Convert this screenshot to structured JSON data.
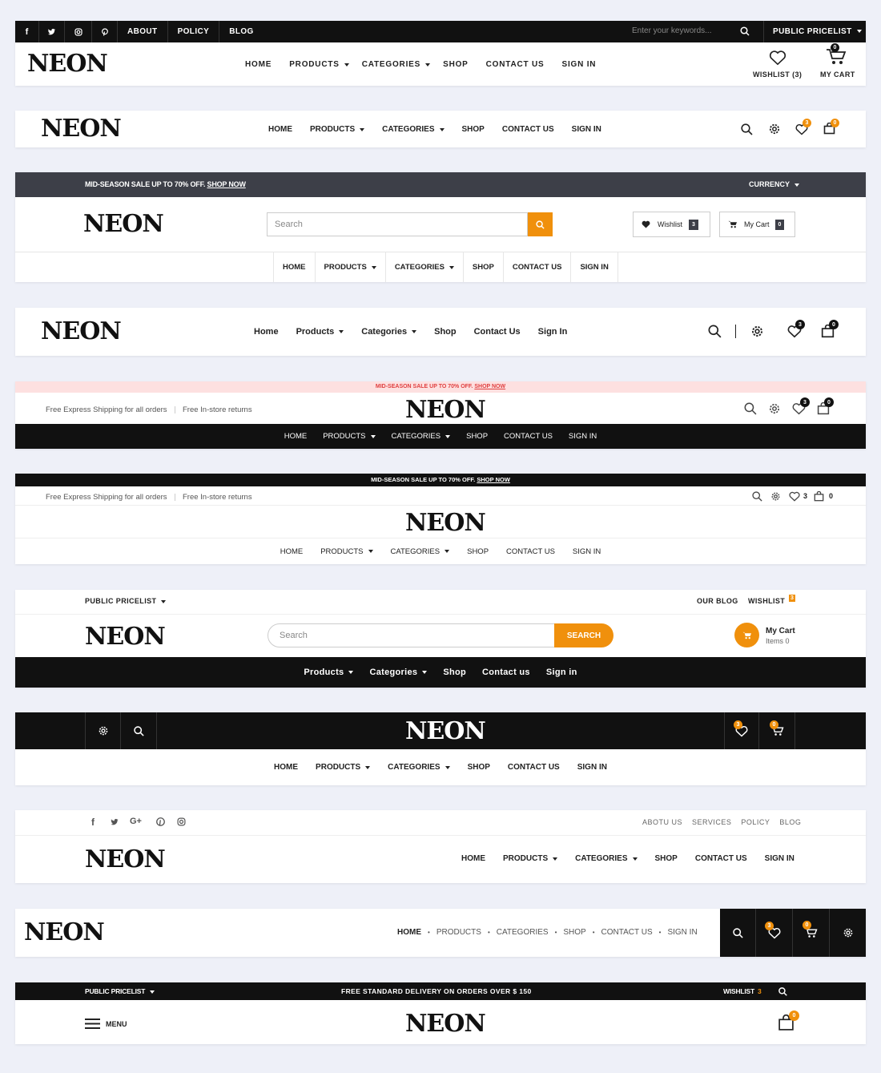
{
  "colors": {
    "accent": "#f0900c",
    "dark": "#111111",
    "slate": "#3d3f48",
    "pink_bar": "#fde0e0",
    "sale_text": "#e04040"
  },
  "h1": {
    "social": [
      "facebook-icon",
      "twitter-icon",
      "instagram-icon",
      "pinterest-icon"
    ],
    "links": [
      "ABOUT",
      "POLICY",
      "BLOG"
    ],
    "search_placeholder": "Enter your keywords...",
    "pricelist": "PUBLIC PRICELIST",
    "logo": "NEON",
    "nav": [
      "HOME",
      "PRODUCTS",
      "CATEGORIES",
      "SHOP",
      "CONTACT US",
      "SIGN IN"
    ],
    "wishlist": "WISHLIST (3)",
    "cart": "MY CART",
    "cart_count": "0"
  },
  "h2": {
    "logo": "NEON",
    "nav": [
      "HOME",
      "PRODUCTS",
      "CATEGORIES",
      "SHOP",
      "CONTACT US",
      "SIGN IN"
    ],
    "wish_count": "3",
    "cart_count": "0"
  },
  "h3": {
    "sale": "MID-SEASON SALE UP TO 70% OFF.",
    "shop_now": "SHOP NOW",
    "currency": "CURRENCY",
    "logo": "NEON",
    "search_placeholder": "Search",
    "wishlist": "Wishlist",
    "wish_count": "3",
    "cart": "My Cart",
    "cart_count": "0",
    "nav": [
      "HOME",
      "PRODUCTS",
      "CATEGORIES",
      "SHOP",
      "CONTACT US",
      "SIGN IN"
    ]
  },
  "h4": {
    "logo": "NEON",
    "nav": [
      "Home",
      "Products",
      "Categories",
      "Shop",
      "Contact Us",
      "Sign In"
    ],
    "wish_count": "3",
    "cart_count": "0"
  },
  "h5": {
    "sale": "MID-SEASON SALE UP TO 70% OFF.",
    "shop_now": "SHOP NOW",
    "shipping": "Free Express Shipping for all orders",
    "returns": "Free In-store returns",
    "logo": "NEON",
    "wish_count": "3",
    "cart_count": "0",
    "nav": [
      "HOME",
      "PRODUCTS",
      "CATEGORIES",
      "SHOP",
      "CONTACT US",
      "SIGN IN"
    ]
  },
  "h6": {
    "sale": "MID-SEASON SALE UP TO 70% OFF.",
    "shop_now": "SHOP NOW",
    "shipping": "Free Express Shipping for all orders",
    "returns": "Free In-store returns",
    "wish_count": "3",
    "cart_count": "0",
    "logo": "NEON",
    "nav": [
      "HOME",
      "PRODUCTS",
      "CATEGORIES",
      "SHOP",
      "CONTACT US",
      "SIGN IN"
    ]
  },
  "h7": {
    "pricelist": "PUBLIC PRICELIST",
    "blog": "OUR BLOG",
    "wishlist": "WISHLIST",
    "wish_count": "3",
    "logo": "NEON",
    "search_placeholder": "Search",
    "search_btn": "SEARCH",
    "cart_title": "My Cart",
    "cart_items": "Items 0",
    "nav": [
      "Products",
      "Categories",
      "Shop",
      "Contact us",
      "Sign in"
    ]
  },
  "h8": {
    "logo": "NEON",
    "wish_count": "3",
    "cart_count": "0",
    "nav": [
      "HOME",
      "PRODUCTS",
      "CATEGORIES",
      "SHOP",
      "CONTACT US",
      "SIGN IN"
    ]
  },
  "h9": {
    "social": [
      "facebook-icon",
      "twitter-icon",
      "google-plus-icon",
      "pinterest-icon",
      "instagram-icon"
    ],
    "links": [
      "ABOTU US",
      "SERVICES",
      "POLICY",
      "BLOG"
    ],
    "logo": "NEON",
    "nav": [
      "HOME",
      "PRODUCTS",
      "CATEGORIES",
      "SHOP",
      "CONTACT US",
      "SIGN IN"
    ]
  },
  "h10": {
    "logo": "NEON",
    "nav": [
      "HOME",
      "PRODUCTS",
      "CATEGORIES",
      "SHOP",
      "CONTACT US",
      "SIGN IN"
    ],
    "wish_count": "3",
    "cart_count": "0"
  },
  "h11": {
    "pricelist": "PUBLIC PRICELIST",
    "delivery": "FREE STANDARD DELIVERY ON ORDERS OVER $ 150",
    "wishlist": "WISHLIST",
    "wish_count": "3",
    "menu": "MENU",
    "logo": "NEON",
    "cart_count": "0"
  }
}
